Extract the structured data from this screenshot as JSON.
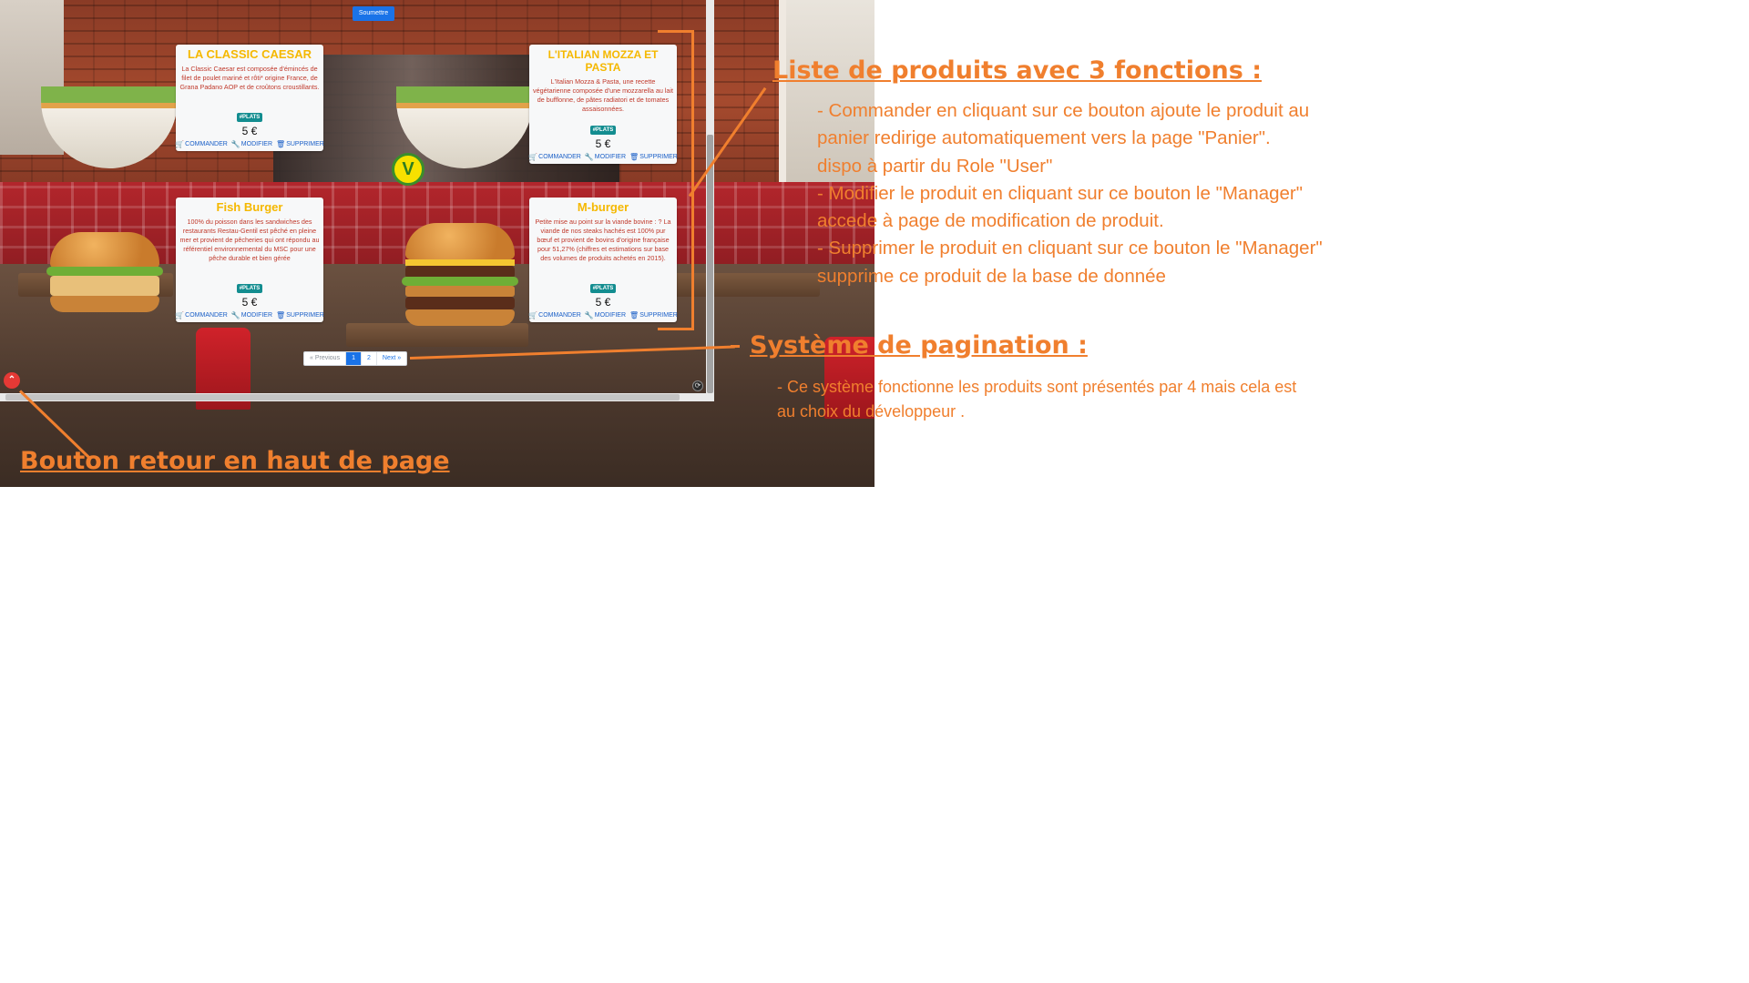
{
  "app": {
    "submit_label": "Soumettre"
  },
  "products": [
    {
      "title": "LA CLASSIC CAESAR",
      "description": "La Classic Caesar est composée d'émincés de filet de poulet mariné et rôti* origine France, de Grana Padano AOP et de croûtons croustillants.",
      "tag": "#PLATS",
      "price": "5 €"
    },
    {
      "title": "L'ITALIAN MOZZA ET PASTA",
      "description": "L'Italian Mozza & Pasta, une recette végétarienne composée d'une mozzarella au lait de bufflonne, de pâtes radiatori et de tomates assaisonnées.",
      "tag": "#PLATS",
      "price": "5 €"
    },
    {
      "title": "Fish Burger",
      "description": "100% du poisson dans les sandwiches des restaurants Restau-Gentil est pêché en pleine mer et provient de pêcheries qui ont répondu au référentiel environnemental du MSC pour une pêche durable et bien gérée",
      "tag": "#PLATS",
      "price": "5 €"
    },
    {
      "title": "M-burger",
      "description": "Petite mise au point sur la viande bovine : ? La viande de nos steaks hachés est 100% pur bœuf et provient de bovins d'origine française pour 51,27% (chiffres et estimations sur base des volumes de produits achetés en 2015).",
      "tag": "#PLATS",
      "price": "5 €"
    }
  ],
  "card_actions": {
    "order": "COMMANDER",
    "edit": "MODIFIER",
    "delete": "SUPPRIMER"
  },
  "pagination": {
    "previous": "« Previous",
    "pages": [
      "1",
      "2"
    ],
    "current_page": "1",
    "next": "Next »"
  },
  "icons": {
    "order": "cart-icon",
    "edit": "wrench-icon",
    "delete": "trash-icon",
    "back_to_top": "chevron-up-icon",
    "veg": "vegetarian-label-icon"
  },
  "annotations": {
    "products": {
      "title": "Liste de produits avec 3 fonctions :",
      "lines": [
        "- Commander en cliquant sur ce bouton ajoute le produit au",
        "panier redirige automatiquement vers la page \"Panier\".",
        "dispo à partir du Role \"User\"",
        "- Modifier le produit en cliquant sur ce bouton le \"Manager\"",
        "accede à page de modification de produit.",
        "- Supprimer le produit en cliquant sur ce bouton le \"Manager\"",
        "supprime ce produit de la base de donnée"
      ]
    },
    "pagination": {
      "title": "Système de pagination :",
      "lines": [
        "- Ce système fonctionne les produits sont présentés par 4 mais cela est",
        "au choix du développeur ."
      ]
    },
    "back_to_top": {
      "title": "Bouton retour en haut de page"
    }
  },
  "colors": {
    "annotation": "#f07f2e",
    "card_title": "#f5b800",
    "card_description": "#c0392b",
    "link": "#1a5fc7",
    "primary": "#1a73e8",
    "tag": "#138d90"
  }
}
